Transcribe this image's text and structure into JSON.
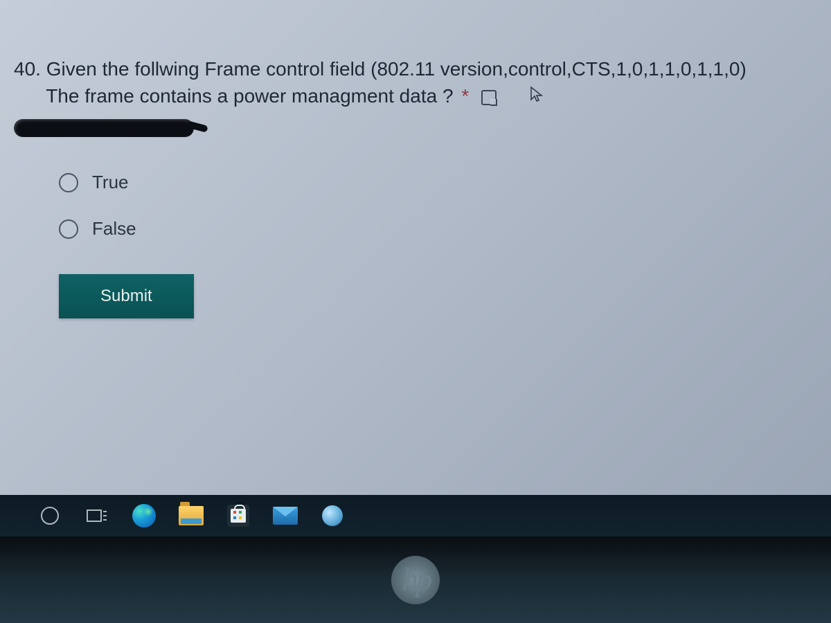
{
  "question": {
    "number_prefix": "40.",
    "text_line1": "Given the follwing Frame control field (802.11 version,control,CTS,1,0,1,1,0,1,1,0)",
    "text_line2": "The frame contains a power managment data ?",
    "required": "*"
  },
  "options": {
    "opt_true": "True",
    "opt_false": "False"
  },
  "submit_label": "Submit",
  "taskbar": {
    "cortana": "Cortana",
    "taskview": "Task View",
    "edge": "Microsoft Edge",
    "explorer": "File Explorer",
    "store": "Microsoft Store",
    "mail": "Mail",
    "browser": "Browser"
  },
  "logo": "hp"
}
